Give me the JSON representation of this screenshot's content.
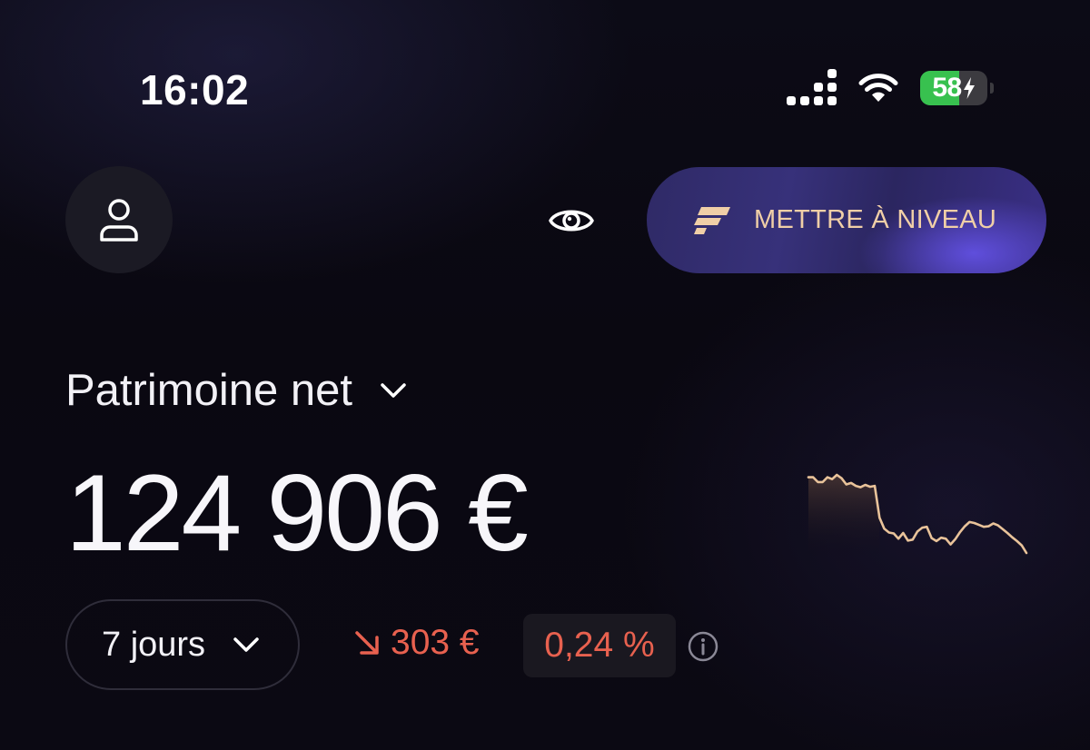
{
  "status_bar": {
    "time": "16:02",
    "battery_percent": "58",
    "battery_level": 0.58,
    "icons": [
      "signal-icon",
      "wifi-icon",
      "battery-icon",
      "charging-bolt-icon"
    ]
  },
  "header": {
    "avatar_icon": "user-icon",
    "visibility_icon": "eye-icon",
    "upgrade": {
      "label": "METTRE À NIVEAU",
      "icon": "brand-logo-icon"
    }
  },
  "net_worth": {
    "title": "Patrimoine net",
    "amount": "124 906 €"
  },
  "change": {
    "period": "7 jours",
    "amount": "303 €",
    "percent": "0,24 %",
    "direction_icon": "arrow-down-right-icon",
    "info_icon": "info-icon"
  },
  "colors": {
    "accent": "#f0cfa7",
    "negative": "#e8614f",
    "upgrade_bg": "#37317a",
    "sparkline": "#e9c39a"
  },
  "sparkline": {
    "values": [
      100,
      100,
      99,
      99,
      100,
      99.6,
      100.5,
      99.8,
      98.5,
      98.8,
      98.2,
      97.9,
      98.4,
      98.0,
      98.2,
      91.5,
      89.2,
      88.4,
      88.2,
      87.1,
      88.3,
      86.7,
      86.9,
      88.6,
      89.4,
      89.6,
      87.2,
      86.6,
      87.3,
      87.1,
      85.9,
      87.0,
      88.5,
      89.7,
      90.6,
      90.4,
      90.0,
      89.6,
      89.7,
      90.3,
      89.9,
      89.1,
      88.3,
      87.4,
      86.6,
      85.7,
      84.1
    ]
  }
}
